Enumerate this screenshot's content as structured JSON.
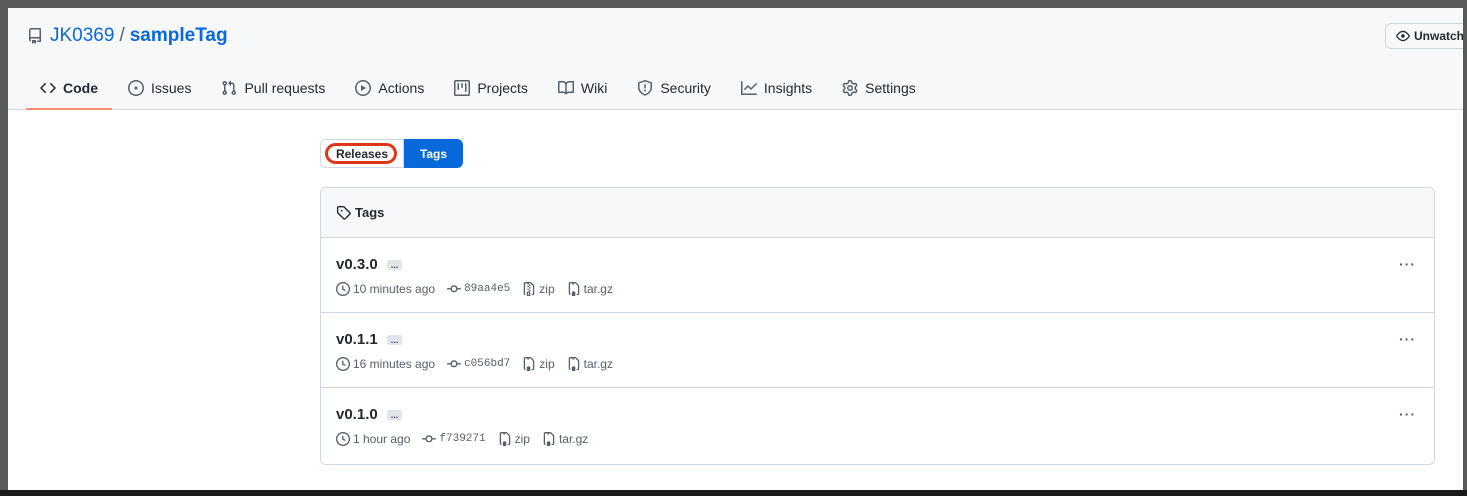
{
  "repo": {
    "owner": "JK0369",
    "separator": "/",
    "name": "sampleTag",
    "unwatch_label": "Unwatch"
  },
  "tabs": [
    {
      "label": "Code",
      "icon": "code-icon",
      "active": true
    },
    {
      "label": "Issues",
      "icon": "issue-icon"
    },
    {
      "label": "Pull requests",
      "icon": "pull-request-icon"
    },
    {
      "label": "Actions",
      "icon": "play-icon"
    },
    {
      "label": "Projects",
      "icon": "project-icon"
    },
    {
      "label": "Wiki",
      "icon": "book-icon"
    },
    {
      "label": "Security",
      "icon": "shield-icon"
    },
    {
      "label": "Insights",
      "icon": "graph-icon"
    },
    {
      "label": "Settings",
      "icon": "gear-icon"
    }
  ],
  "subnav": {
    "releases": "Releases",
    "tags": "Tags"
  },
  "tags_box": {
    "header": "Tags",
    "tags": [
      {
        "name": "v0.3.0",
        "time": "10 minutes ago",
        "sha": "89aa4e5",
        "zip": "zip",
        "targz": "tar.gz"
      },
      {
        "name": "v0.1.1",
        "time": "16 minutes ago",
        "sha": "c056bd7",
        "zip": "zip",
        "targz": "tar.gz"
      },
      {
        "name": "v0.1.0",
        "time": "1 hour ago",
        "sha": "f739271",
        "zip": "zip",
        "targz": "tar.gz"
      }
    ],
    "ellipsis": "...",
    "kebab": "···"
  },
  "colors": {
    "link": "#0969da",
    "active_tab_underline": "#fd8c73",
    "highlight_circle": "#e0341b"
  }
}
